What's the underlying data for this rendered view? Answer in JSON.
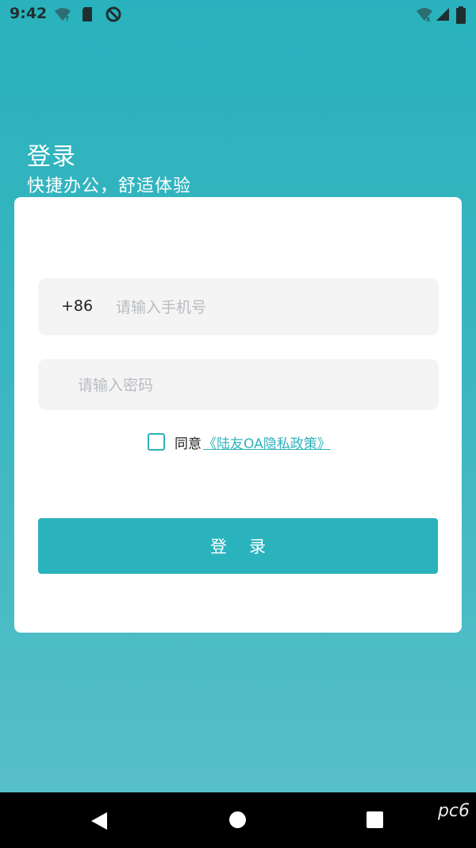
{
  "status_bar": {
    "time": "9:42",
    "icons": [
      "wifi-question-icon",
      "sd-card-icon",
      "no-disturb-icon",
      "wifi-off-icon",
      "signal-icon",
      "battery-icon"
    ]
  },
  "header": {
    "title": "登录",
    "subtitle": "快捷办公，舒适体验"
  },
  "form": {
    "phone_prefix": "+86",
    "phone_placeholder": "请输入手机号",
    "phone_value": "",
    "password_placeholder": "请输入密码",
    "password_value": "",
    "agree_checked": false,
    "agree_text": "同意",
    "policy_link": "《陆友OA隐私政策》",
    "login_label": "登录"
  },
  "nav_bar": {
    "buttons": [
      "back",
      "home",
      "recent-apps"
    ]
  },
  "watermark": {
    "text": "pc6"
  },
  "colors": {
    "accent": "#2ab3bc",
    "background_top": "#29b2bd",
    "background_bottom": "#5ac0c8",
    "card": "#ffffff",
    "input_bg": "#f4f4f5",
    "placeholder": "#b9bcc0"
  }
}
